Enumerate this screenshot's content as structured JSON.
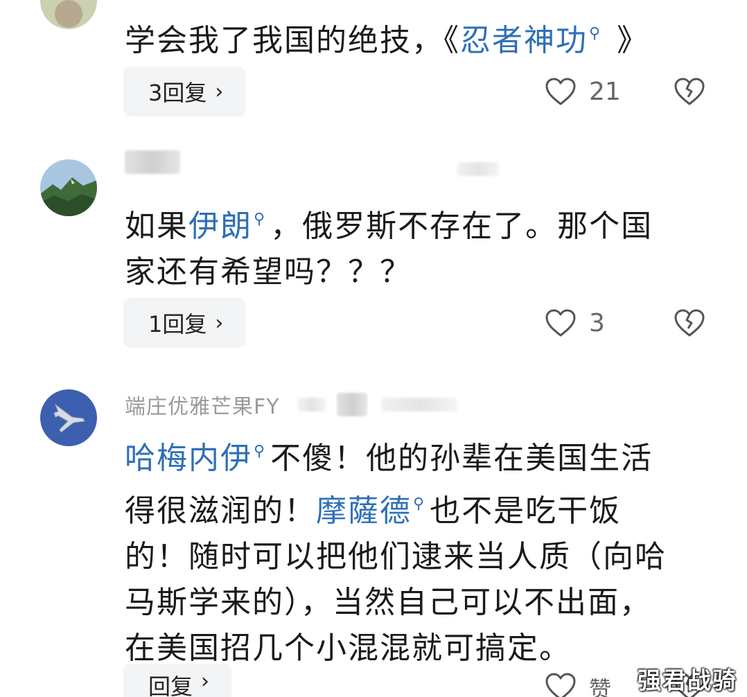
{
  "comments": [
    {
      "text_lines": [
        {
          "before": "学会我了我国的绝技，《",
          "link": "忍者神功",
          "after": " 》"
        }
      ],
      "reply_label": "3回复",
      "like_count": "21"
    },
    {
      "text_lines": [
        {
          "before": "如果",
          "link": "伊朗",
          "after": "，俄罗斯不存在了。那个国"
        },
        {
          "before": "家还有希望吗？？？",
          "link": "",
          "after": ""
        }
      ],
      "reply_label": "1回复",
      "like_count": "3"
    },
    {
      "username": "端庄优雅芒果FY",
      "text_lines": [
        {
          "before": "",
          "link": "哈梅内伊",
          "after": "不傻！他的孙辈在美国生活"
        },
        {
          "before": "得很滋润的！",
          "link": "摩薩德",
          "after": "也不是吃干饭"
        },
        {
          "before": "的！随时可以把他们逮来当人质（向哈",
          "link": "",
          "after": ""
        },
        {
          "before": "马斯学来的），当然自己可以不出面，",
          "link": "",
          "after": ""
        },
        {
          "before": "在美国招几个小混混就可搞定。",
          "link": "",
          "after": ""
        }
      ],
      "reply_label": "回复",
      "like_count": "赞"
    }
  ],
  "icons": {
    "search_mark": "🔍",
    "chevron": "›",
    "like": "heart-outline-icon",
    "dislike": "broken-heart-icon"
  },
  "colors": {
    "link": "#2e6fb7",
    "username": "#9a9a9a",
    "reply_bg": "#f3f4f6"
  },
  "watermark": "强君战骑"
}
